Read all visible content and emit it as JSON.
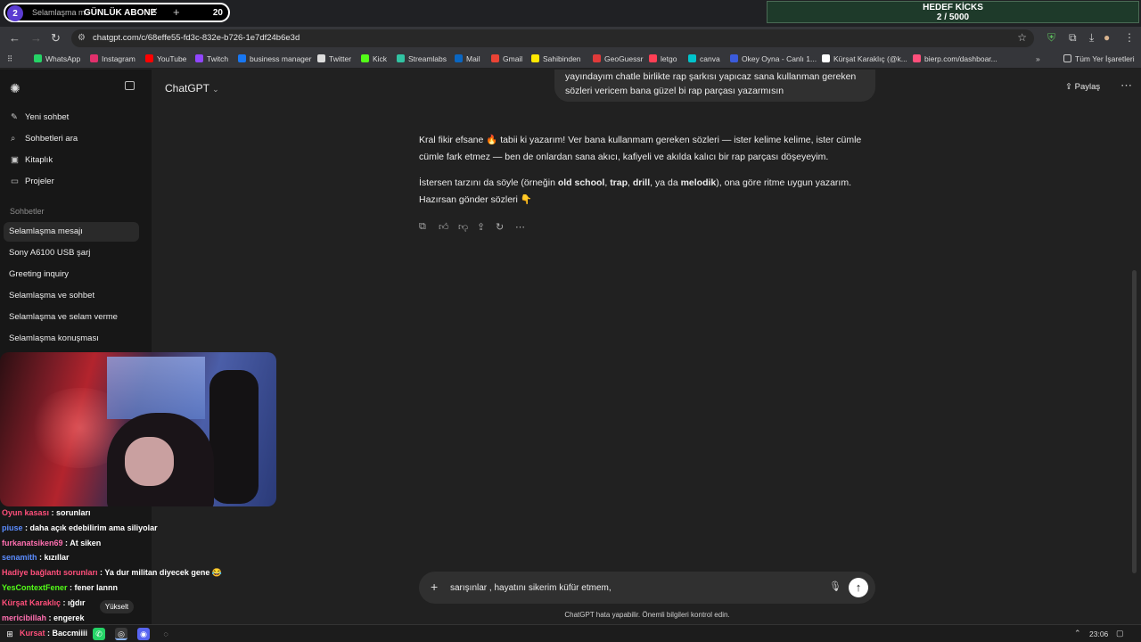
{
  "browser": {
    "tab_title": "Selamlaşma m",
    "url": "chatgpt.com/c/68effe55-fd3c-832e-b726-1e7df24b6e3d",
    "bookmarks": [
      {
        "label": "WhatsApp",
        "color": "#25d366"
      },
      {
        "label": "Instagram",
        "color": "#e1306c"
      },
      {
        "label": "YouTube",
        "color": "#ff0000"
      },
      {
        "label": "Twitch",
        "color": "#9146ff"
      },
      {
        "label": "business manager",
        "color": "#1877f2"
      },
      {
        "label": "Twitter",
        "color": "#dddddd"
      },
      {
        "label": "Kick",
        "color": "#53fc18"
      },
      {
        "label": "Streamlabs",
        "color": "#31c3a2"
      },
      {
        "label": "Mail",
        "color": "#0a66c2"
      },
      {
        "label": "Gmail",
        "color": "#ea4335"
      },
      {
        "label": "Sahibinden",
        "color": "#ffe800"
      },
      {
        "label": "GeoGuessr",
        "color": "#e03a3a"
      },
      {
        "label": "letgo",
        "color": "#ff3f55"
      },
      {
        "label": "canva",
        "color": "#00c4cc"
      },
      {
        "label": "Okey Oyna - Canlı 1...",
        "color": "#3b5bdb"
      },
      {
        "label": "Kürşat Karaklıç (@k...",
        "color": "#ffffff"
      },
      {
        "label": "bierp.com/dashboar...",
        "color": "#ff4f7b"
      }
    ],
    "all_bookmarks": "Tüm Yer İşaretleri"
  },
  "overlay": {
    "badge": "2",
    "subs_label": "GÜNLÜK ABONE",
    "subs_count": "20",
    "goal_title": "HEDEF KİCKS",
    "goal_progress": "2 / 5000"
  },
  "sidebar": {
    "items": [
      {
        "label": "Yeni sohbet",
        "icon": "✎"
      },
      {
        "label": "Sohbetleri ara",
        "icon": "⌕"
      },
      {
        "label": "Kitaplık",
        "icon": "▣"
      },
      {
        "label": "Projeler",
        "icon": "▭"
      }
    ],
    "heading": "Sohbetler",
    "chats": [
      "Selamlaşma mesajı",
      "Sony A6100 USB şarj",
      "Greeting inquiry",
      "Selamlaşma ve sohbet",
      "Selamlaşma ve selam verme",
      "Selamlaşma konuşması"
    ]
  },
  "main": {
    "model": "ChatGPT",
    "share": "Paylaş",
    "user_message": "yayındayım chatle birlikte rap şarkısı yapıcaz sana kullanman gereken sözleri vericem bana güzel bi rap parçası yazarmısın",
    "assistant_p1": "Kral fikir efsane 🔥 tabii ki yazarım! Ver bana kullanmam gereken sözleri — ister kelime kelime, ister cümle cümle fark etmez — ben de onlardan sana akıcı, kafiyeli ve akılda kalıcı bir rap parçası döşeyeyim.",
    "assistant_p2_a": "İstersen tarzını da söyle (örneğin ",
    "assistant_p2_b1": "old school",
    "assistant_p2_c1": ", ",
    "assistant_p2_b2": "trap",
    "assistant_p2_c2": ", ",
    "assistant_p2_b3": "drill",
    "assistant_p2_c3": ", ya da ",
    "assistant_p2_b4": "melodik",
    "assistant_p2_c4": "), ona göre ritme uygun yazarım.",
    "assistant_p3": "Hazırsan gönder sözleri 👇",
    "composer_text": "sarışınlar , hayatını sikerim küfür etmem,",
    "disclaimer": "ChatGPT hata yapabilir. Önemli bilgileri kontrol edin."
  },
  "stream_chat": [
    {
      "user": "Oyun kasası",
      "color": "#ff4f7b",
      "msg": "sorunları"
    },
    {
      "user": "piuse",
      "color": "#5b8cff",
      "msg": "daha açık edebilirim ama siliyolar"
    },
    {
      "user": "furkanatsiken69",
      "color": "#ff6fb0",
      "msg": "At siken"
    },
    {
      "user": "senamith",
      "color": "#5b8cff",
      "msg": "kızıllar"
    },
    {
      "user": "Hadiye bağlantı sorunları",
      "color": "#ff4f7b",
      "msg": "Ya dur militan diyecek gene 😂"
    },
    {
      "user": "YesContextFener",
      "color": "#53fc18",
      "msg": "fener lannn"
    },
    {
      "user": "Kürşat Karaklıç",
      "color": "#ff4f7b",
      "msg": "ığdır"
    },
    {
      "user": "mericibillah",
      "color": "#ff6fb0",
      "msg": "engerek"
    },
    {
      "user": "Kursat",
      "color": "#ff4f7b",
      "msg": "Baccmiiii"
    }
  ],
  "stream_misc": {
    "upgrade": "Yükselt"
  },
  "taskbar": {
    "clock": "23:06"
  }
}
